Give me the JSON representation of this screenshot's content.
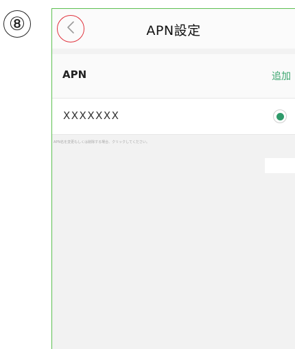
{
  "step_badge": "⑧",
  "navbar": {
    "title": "APN設定"
  },
  "apn_section": {
    "label": "APN",
    "add_label": "追加"
  },
  "apn_list": [
    {
      "name": "XXXXXXX",
      "selected": true
    }
  ],
  "note": "APN名を変更もしくは削除する場合、クリックしてください。",
  "colors": {
    "accent_green": "#3aa56e",
    "radio_green": "#2f9a6a",
    "frame_green": "#5bbf4f",
    "highlight_red": "#e0303a"
  }
}
